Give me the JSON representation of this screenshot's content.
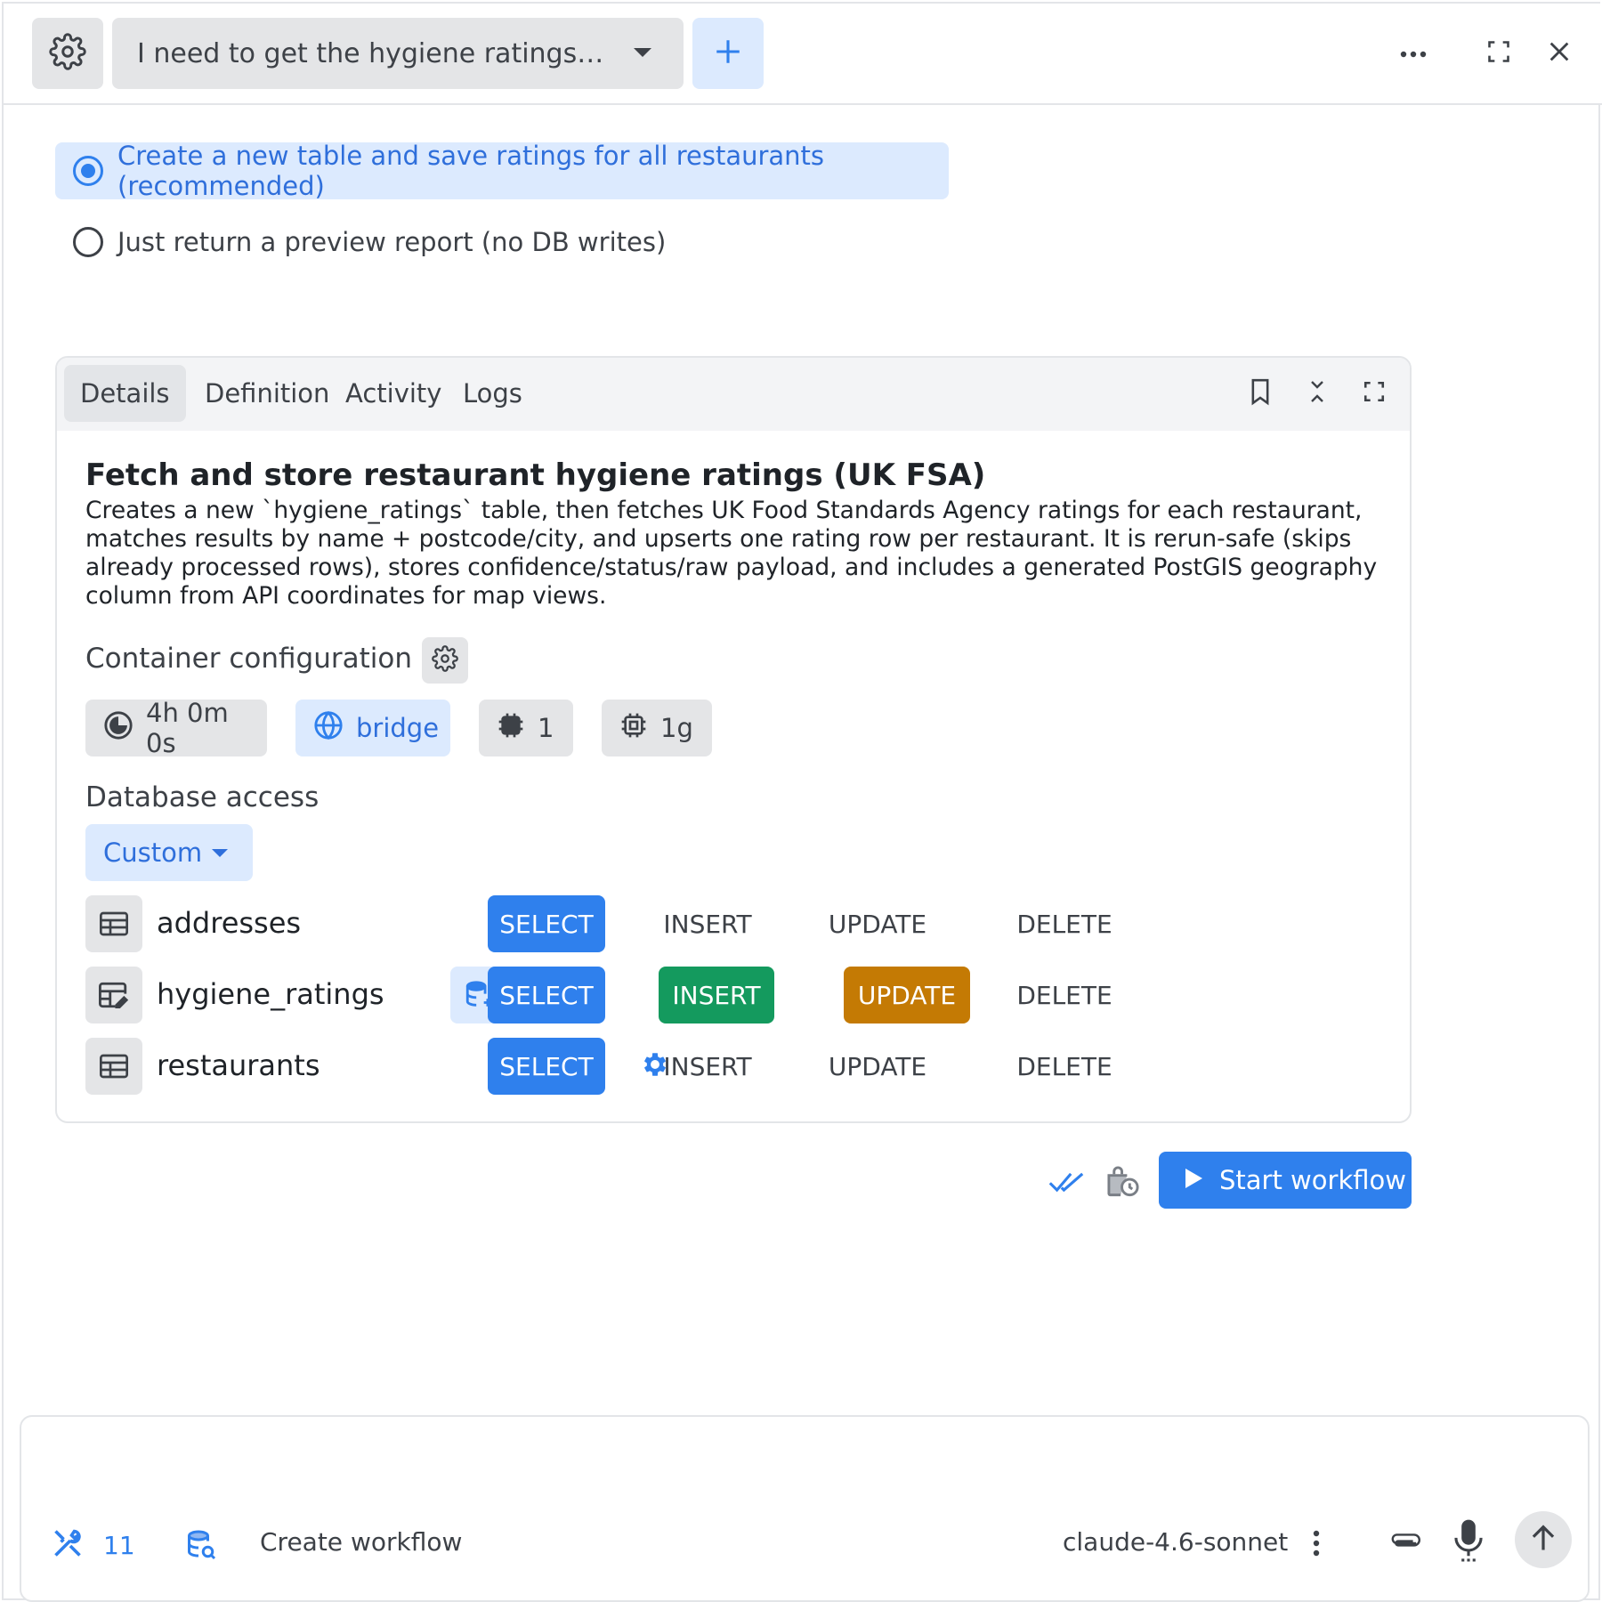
{
  "topbar": {
    "conversation_title": "I need to get the hygiene ratings f...",
    "icons": [
      "gear-icon",
      "chevron-down-icon",
      "plus-icon",
      "more-horizontal-icon",
      "fullscreen-icon",
      "close-icon"
    ]
  },
  "options": {
    "selected_label": "Create a new table and save ratings for all restaurants (recommended)",
    "other_label": "Just return a preview report (no DB writes)"
  },
  "card": {
    "tabs": [
      "Details",
      "Definition",
      "Activity",
      "Logs"
    ],
    "active_tab": "Details",
    "title": "Fetch and store restaurant hygiene ratings (UK FSA)",
    "description": "Creates a new `hygiene_ratings` table, then fetches UK Food Standards Agency ratings for each restaurant, matches results by name + postcode/city, and upserts one rating row per restaurant. It is rerun-safe (skips already processed rows), stores confidence/status/raw payload, and includes a generated PostGIS geography column from API coordinates for map views.",
    "container_label": "Container configuration",
    "chips": {
      "timeout": "4h 0m 0s",
      "network": "bridge",
      "cpu": "1",
      "memory": "1g"
    },
    "db_access_label": "Database access",
    "db_access_mode": "Custom",
    "tables": [
      {
        "name": "addresses",
        "select": "SELECT",
        "insert": "INSERT",
        "update": "UPDATE",
        "delete": "DELETE"
      },
      {
        "name": "hygiene_ratings",
        "select": "SELECT",
        "insert": "INSERT",
        "update": "UPDATE",
        "delete": "DELETE"
      },
      {
        "name": "restaurants",
        "select": "SELECT",
        "insert": "INSERT",
        "update": "UPDATE",
        "delete": "DELETE"
      }
    ]
  },
  "actions": {
    "start_label": "Start workflow"
  },
  "composer": {
    "tools_count": "11",
    "mode_label": "Create workflow",
    "model": "claude-4.6-sonnet"
  },
  "colors": {
    "accent": "#2f80ed",
    "insert_green": "#149a5e",
    "update_amber": "#c47a04",
    "chip_gray": "#e4e5e7",
    "chip_blue": "#dceafe"
  }
}
